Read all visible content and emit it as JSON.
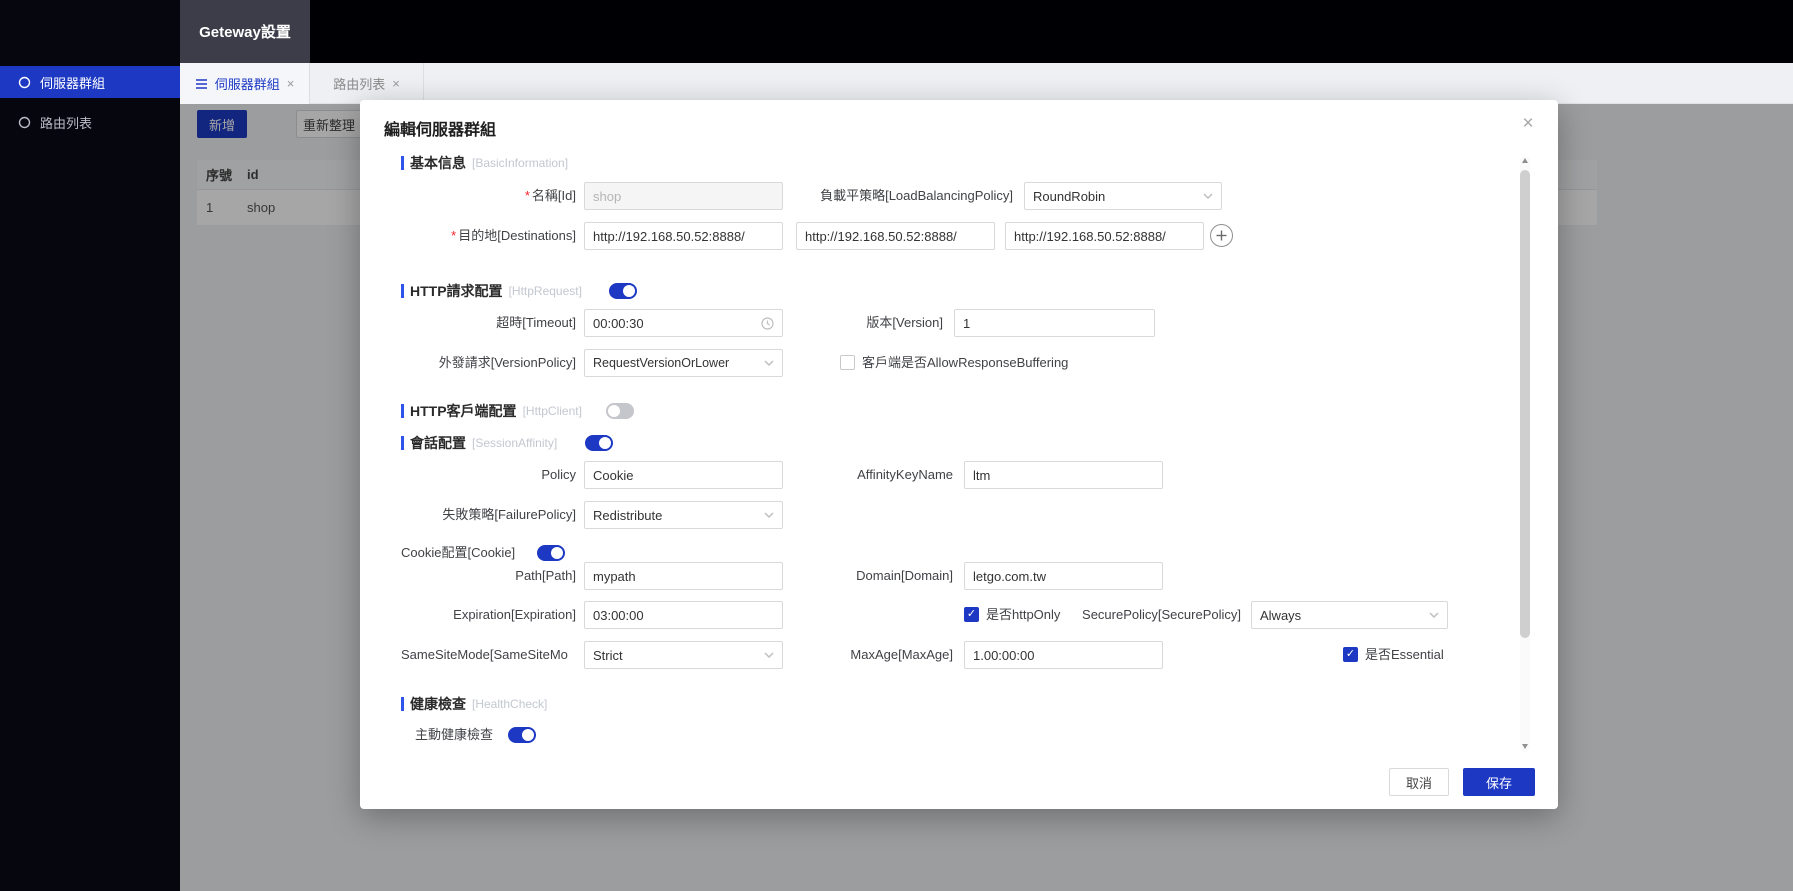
{
  "colors": {
    "primary": "#1d39c4",
    "section_bar": "#2f54eb",
    "required": "#f5222d"
  },
  "required_mark": "*",
  "header": {
    "app_tab": "Geteway設置"
  },
  "sidebar": {
    "items": [
      {
        "label": "伺服器群組",
        "active": true
      },
      {
        "label": "路由列表",
        "active": false
      }
    ]
  },
  "tabbar": {
    "tabs": [
      {
        "label": "伺服器群組",
        "active": true
      },
      {
        "label": "路由列表",
        "active": false
      }
    ],
    "close_glyph": "×"
  },
  "content": {
    "add_button": "新增",
    "refresh_button": "重新整理",
    "table": {
      "columns": [
        "序號",
        "id"
      ],
      "rows": [
        [
          "1",
          "shop"
        ]
      ]
    }
  },
  "modal": {
    "title": "編輯伺服器群組",
    "close_glyph": "×",
    "basic": {
      "title": "基本信息",
      "tag": "[BasicInformation]",
      "name_label": "名稱[Id]",
      "name_value": "shop",
      "lb_label": "負載平策略[LoadBalancingPolicy]",
      "lb_value": "RoundRobin",
      "dest_label": "目的地[Destinations]",
      "dest1": "http://192.168.50.52:8888/",
      "dest2": "http://192.168.50.52:8888/",
      "dest3": "http://192.168.50.52:8888/"
    },
    "http_request": {
      "title": "HTTP請求配置",
      "tag": "[HttpRequest]",
      "enabled": true,
      "timeout_label": "超時[Timeout]",
      "timeout_value": "00:00:30",
      "version_label": "版本[Version]",
      "version_value": "1",
      "version_policy_label": "外發請求[VersionPolicy]",
      "version_policy_value": "RequestVersionOrLower",
      "buffering_label": "客戶端是否AllowResponseBuffering",
      "buffering_checked": false
    },
    "http_client": {
      "title": "HTTP客戶端配置",
      "tag": "[HttpClient]",
      "enabled": false
    },
    "session": {
      "title": "會話配置",
      "tag": "[SessionAffinity]",
      "enabled": true,
      "policy_label": "Policy",
      "policy_value": "Cookie",
      "affinity_label": "AffinityKeyName",
      "affinity_value": "ltm",
      "failure_label": "失敗策略[FailurePolicy]",
      "failure_value": "Redistribute"
    },
    "cookie": {
      "title": "Cookie配置[Cookie]",
      "enabled": true,
      "path_label": "Path[Path]",
      "path_value": "mypath",
      "domain_label": "Domain[Domain]",
      "domain_value": "letgo.com.tw",
      "expiration_label": "Expiration[Expiration]",
      "expiration_value": "03:00:00",
      "httponly_label": "是否httpOnly",
      "httponly_checked": true,
      "secure_label": "SecurePolicy[SecurePolicy]",
      "secure_value": "Always",
      "samesite_label": "SameSiteMode[SameSiteMo",
      "samesite_value": "Strict",
      "maxage_label": "MaxAge[MaxAge]",
      "maxage_value": "1.00:00:00",
      "essential_label": "是否Essential",
      "essential_checked": true
    },
    "health": {
      "title": "健康檢查",
      "tag": "[HealthCheck]",
      "active_label": "主動健康檢查",
      "active_enabled": true
    },
    "footer": {
      "cancel": "取消",
      "save": "保存"
    }
  }
}
